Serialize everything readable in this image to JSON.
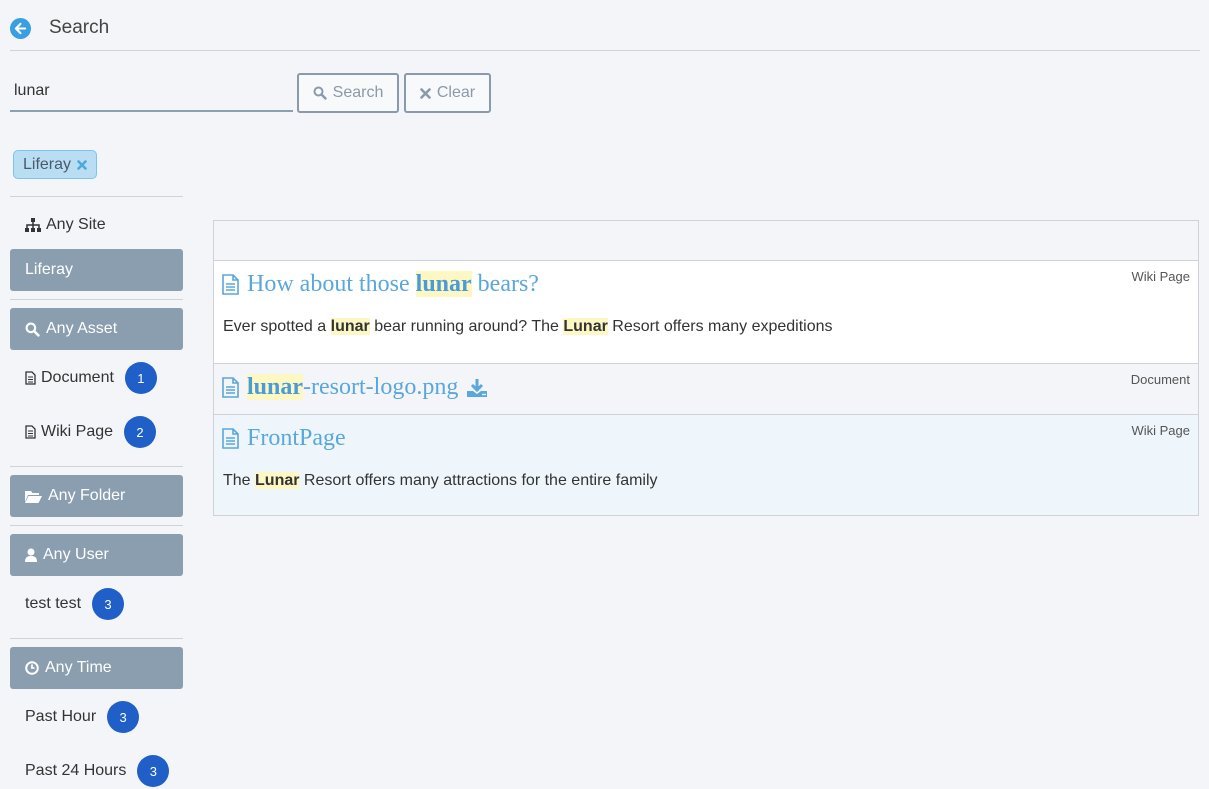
{
  "header": {
    "title": "Search"
  },
  "search": {
    "query": "lunar",
    "search_label": "Search",
    "clear_label": "Clear"
  },
  "filter_tag": {
    "label": "Liferay"
  },
  "sites": {
    "any_label": "Any Site",
    "selected": "Liferay"
  },
  "assets": {
    "header": "Any Asset",
    "items": [
      {
        "label": "Document",
        "count": "1"
      },
      {
        "label": "Wiki Page",
        "count": "2"
      }
    ]
  },
  "folders": {
    "header": "Any Folder"
  },
  "users": {
    "header": "Any User",
    "items": [
      {
        "label": "test test",
        "count": "3"
      }
    ]
  },
  "time": {
    "header": "Any Time",
    "items": [
      {
        "label": "Past Hour",
        "count": "3"
      },
      {
        "label": "Past 24 Hours",
        "count": "3"
      }
    ]
  },
  "results": [
    {
      "title_pre": "How about those ",
      "title_hl": "lunar",
      "title_post": " bears?",
      "type": "Wiki Page",
      "snippet": {
        "p1": "Ever spotted a ",
        "h1": "lunar",
        "p2": " bear running around? The ",
        "h2": "Lunar",
        "p3": " Resort offers many expeditions"
      }
    },
    {
      "title_hl": "lunar",
      "title_post": "-resort-logo.png",
      "type": "Document"
    },
    {
      "title": "FrontPage",
      "type": "Wiki Page",
      "snippet": {
        "p1": "The ",
        "h1": "Lunar",
        "p2": " Resort offers many attractions for the entire family"
      }
    }
  ],
  "colors": {
    "accent": "#5aa7dc",
    "badge": "#1f5fc7",
    "facet_header": "#8a9eb0",
    "highlight": "#fdf7c4"
  }
}
